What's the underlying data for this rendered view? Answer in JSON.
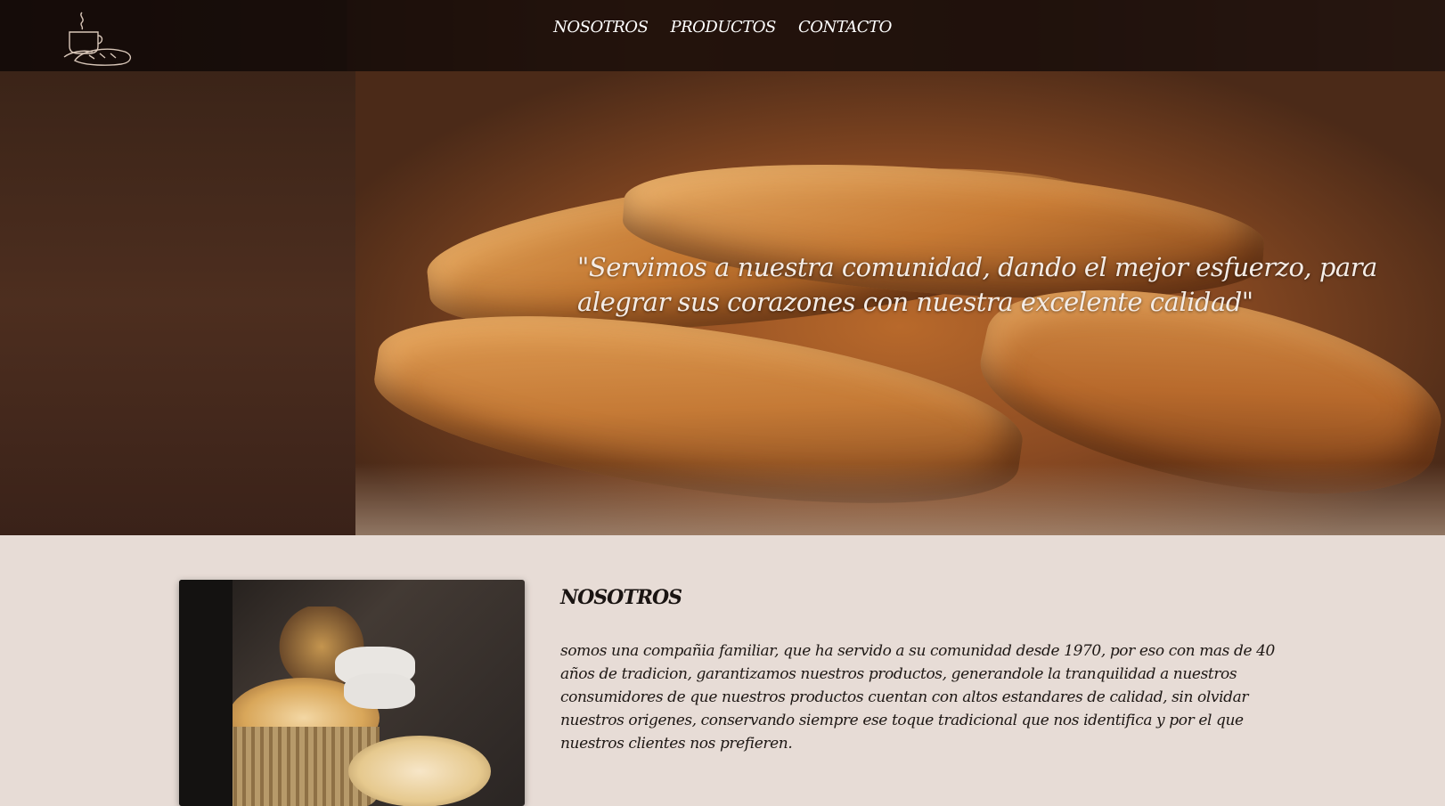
{
  "nav": {
    "logo_icon": "coffee-bread-logo-icon",
    "items": [
      {
        "label": "NOSOTROS"
      },
      {
        "label": "PRODUCTOS"
      },
      {
        "label": "CONTACTO"
      }
    ]
  },
  "hero": {
    "quote": "\"Servimos a nuestra comunidad, dando el mejor esfuerzo, para alegrar sus corazones con nuestra excelente calidad\""
  },
  "about": {
    "title": "NOSOTROS",
    "text": "somos una compañia familiar, que ha servido a su comunidad desde 1970, por eso con mas de 40 años de tradicion, garantizamos nuestros productos, generandole la tranquilidad a nuestros consumidores de que nuestros productos cuentan con altos estandares de calidad, sin olvidar nuestros origenes, conservando siempre ese toque tradicional que nos identifica y por el que nuestros clientes nos prefieren."
  },
  "colors": {
    "nav_bg": "#0f0806",
    "page_bg": "#e7dcd6",
    "text_dark": "#1a1412",
    "hero_text": "#f4ece6"
  }
}
